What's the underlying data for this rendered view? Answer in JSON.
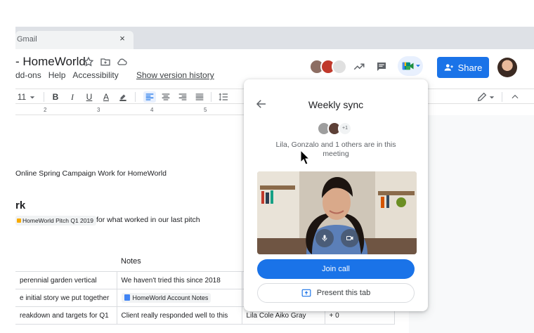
{
  "browser": {
    "tab_title": "Gmail",
    "close_glyph": "×"
  },
  "doc": {
    "title": "- HomeWorld",
    "menus": [
      "dd-ons",
      "Help",
      "Accessibility"
    ],
    "version_link": "Show version history",
    "share_label": "Share",
    "accent": "#1a73e8"
  },
  "toolbar": {
    "font_size": "11",
    "bold": "B",
    "italic": "I",
    "underline": "U",
    "text_color": "A"
  },
  "ruler": {
    "marks": [
      "2",
      "3",
      "4",
      "5"
    ]
  },
  "body": {
    "paragraph1": "Online Spring Campaign Work for HomeWorld",
    "heading": "rk",
    "chip_label": "HomeWorld Pitch Q1 2019",
    "paragraph2": "for what worked in our last pitch",
    "notes_header": "Notes",
    "table": [
      {
        "c1": "perennial garden vertical",
        "c2": "We haven't tried this since 2018",
        "c3": "",
        "c4": ""
      },
      {
        "c1": "e initial story we put together",
        "c2": "HomeWorld Account Notes",
        "c3": "",
        "c4": ""
      },
      {
        "c1": "reakdown and targets for Q1",
        "c2": "Client really responded well to this",
        "c3": "Lila Cole   Aiko Gray",
        "c4": "+ 0"
      }
    ]
  },
  "meet": {
    "title": "Weekly sync",
    "more_count": "+1",
    "status": "Lila, Gonzalo and 1 others are in this meeting",
    "join_label": "Join call",
    "present_label": "Present this tab"
  },
  "icons": {
    "star": "star-icon",
    "folder": "folder-move-icon",
    "cloud": "cloud-status-icon",
    "trend": "activity-trend-icon",
    "comment": "comment-icon",
    "meet": "google-meet-icon",
    "share": "person-add-icon",
    "back": "back-arrow-icon",
    "mic": "mic-icon",
    "camera": "camera-icon",
    "present": "present-screen-icon"
  }
}
